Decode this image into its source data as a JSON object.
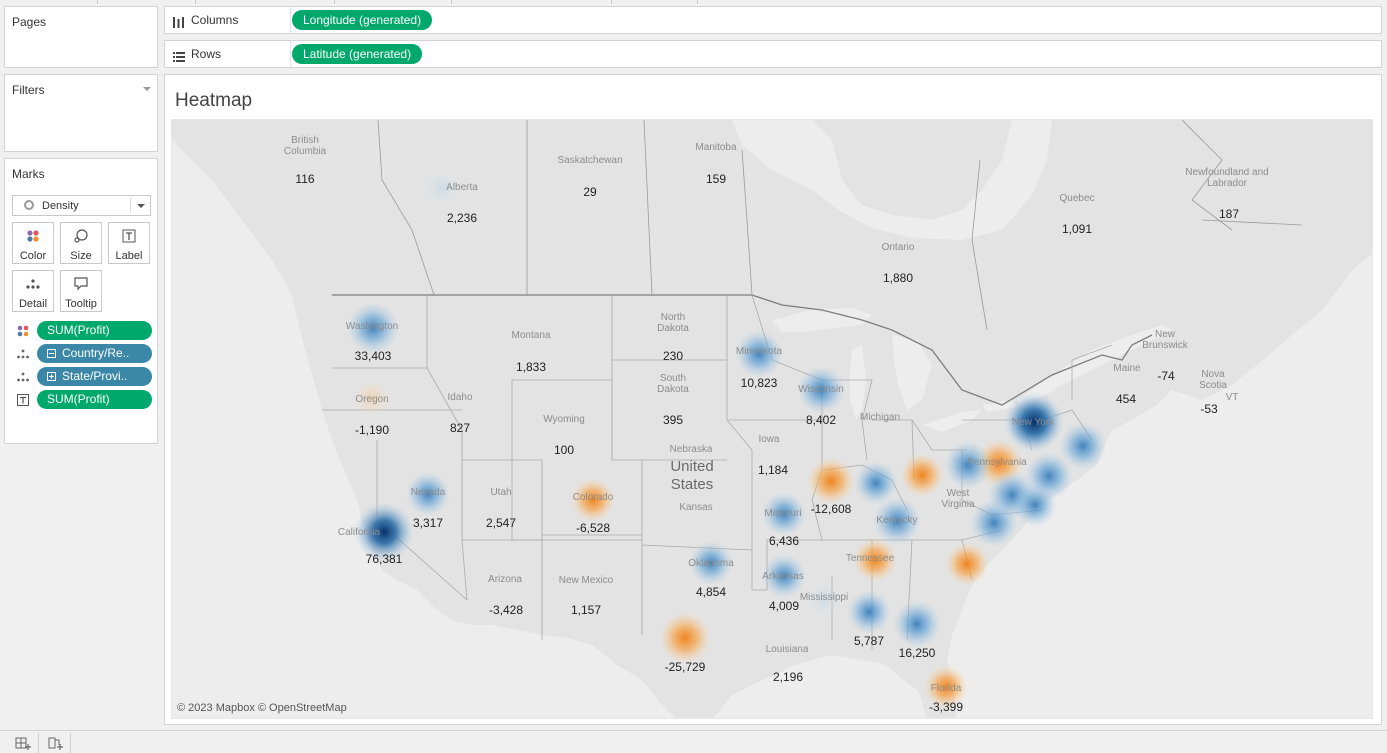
{
  "cards": {
    "pages": "Pages",
    "filters": "Filters",
    "marks": "Marks"
  },
  "marks": {
    "type": "Density",
    "buttons": [
      "Color",
      "Size",
      "Label",
      "Detail",
      "Tooltip"
    ],
    "pills": [
      {
        "icon": "color-icon",
        "label": "SUM(Profit)",
        "color": "green"
      },
      {
        "icon": "detail-icon",
        "label": "Country/Re..",
        "color": "blue",
        "box": "minus"
      },
      {
        "icon": "detail-icon",
        "label": "State/Provi..",
        "color": "blue",
        "box": "plus"
      },
      {
        "icon": "label-icon",
        "label": "SUM(Profit)",
        "color": "green"
      }
    ]
  },
  "shelves": {
    "columns": {
      "label": "Columns",
      "pill": "Longitude (generated)"
    },
    "rows": {
      "label": "Rows",
      "pill": "Latitude (generated)"
    }
  },
  "sheet": {
    "title": "Heatmap",
    "attribution": "© 2023 Mapbox © OpenStreetMap"
  },
  "map": {
    "country_label": [
      "United",
      "States"
    ],
    "place_labels": [
      {
        "text": "British Columbia"
      },
      {
        "text": "Alberta"
      },
      {
        "text": "Saskatchewan"
      },
      {
        "text": "Manitoba"
      },
      {
        "text": "Ontario"
      },
      {
        "text": "Quebec"
      },
      {
        "text": "Newfoundland and Labrador"
      },
      {
        "text": "New Brunswick"
      },
      {
        "text": "Nova Scotia"
      },
      {
        "text": "Maine"
      },
      {
        "text": "VT"
      },
      {
        "text": "Washington"
      },
      {
        "text": "Oregon"
      },
      {
        "text": "Idaho"
      },
      {
        "text": "Montana"
      },
      {
        "text": "Wyoming"
      },
      {
        "text": "North Dakota"
      },
      {
        "text": "South Dakota"
      },
      {
        "text": "Nebraska"
      },
      {
        "text": "Kansas"
      },
      {
        "text": "Iowa"
      },
      {
        "text": "Minnesota"
      },
      {
        "text": "Wisconsin"
      },
      {
        "text": "Michigan"
      },
      {
        "text": "New York"
      },
      {
        "text": "Pennsylvania"
      },
      {
        "text": "West Virginia"
      },
      {
        "text": "Kentucky"
      },
      {
        "text": "Tennessee"
      },
      {
        "text": "Missouri"
      },
      {
        "text": "Oklahoma"
      },
      {
        "text": "Arkansas"
      },
      {
        "text": "Mississippi"
      },
      {
        "text": "Louisiana"
      },
      {
        "text": "Nevada"
      },
      {
        "text": "Utah"
      },
      {
        "text": "Colorado"
      },
      {
        "text": "Arizona"
      },
      {
        "text": "New Mexico"
      },
      {
        "text": "Florida"
      },
      {
        "text": "California"
      }
    ],
    "profit_points": [
      {
        "label": "116",
        "value": 116
      },
      {
        "label": "2,236",
        "value": 2236
      },
      {
        "label": "29",
        "value": 29
      },
      {
        "label": "159",
        "value": 159
      },
      {
        "label": "1,880",
        "value": 1880
      },
      {
        "label": "1,091",
        "value": 1091
      },
      {
        "label": "187",
        "value": 187
      },
      {
        "label": "-74",
        "value": -74
      },
      {
        "label": "-53",
        "value": -53
      },
      {
        "label": "454",
        "value": 454
      },
      {
        "label": "33,403",
        "value": 33403
      },
      {
        "label": "-1,190",
        "value": -1190
      },
      {
        "label": "827",
        "value": 827
      },
      {
        "label": "1,833",
        "value": 1833
      },
      {
        "label": "100",
        "value": 100
      },
      {
        "label": "230",
        "value": 230
      },
      {
        "label": "395",
        "value": 395
      },
      {
        "label": "10,823",
        "value": 10823
      },
      {
        "label": "8,402",
        "value": 8402
      },
      {
        "label": "1,184",
        "value": 1184
      },
      {
        "label": "3,317",
        "value": 3317
      },
      {
        "label": "2,547",
        "value": 2547
      },
      {
        "label": "-6,528",
        "value": -6528
      },
      {
        "label": "76,381",
        "value": 76381
      },
      {
        "label": "-12,608",
        "value": -12608
      },
      {
        "label": "6,436",
        "value": 6436
      },
      {
        "label": "-3,428",
        "value": -3428
      },
      {
        "label": "1,157",
        "value": 1157
      },
      {
        "label": "4,854",
        "value": 4854
      },
      {
        "label": "4,009",
        "value": 4009
      },
      {
        "label": "5,787",
        "value": 5787
      },
      {
        "label": "16,250",
        "value": 16250
      },
      {
        "label": "-25,729",
        "value": -25729
      },
      {
        "label": "2,196",
        "value": 2196
      },
      {
        "label": "-3,399",
        "value": -3399
      }
    ],
    "extra_blobs": [
      {
        "value": 25000
      },
      {
        "value": 8000
      },
      {
        "value": -8000
      },
      {
        "value": -10000
      },
      {
        "value": 12000
      },
      {
        "value": 15000
      },
      {
        "value": 9000
      },
      {
        "value": 10000
      },
      {
        "value": 10000
      },
      {
        "value": 7000
      },
      {
        "value": 12000
      },
      {
        "value": -5000
      },
      {
        "value": -6000
      },
      {
        "value": 3000
      },
      {
        "value": 74000
      }
    ],
    "colors": {
      "positive": "#2f78b8",
      "negative": "#f28e2b",
      "land": "#e3e3e3",
      "water": "#ededed",
      "border": "#8a8a8a"
    }
  }
}
